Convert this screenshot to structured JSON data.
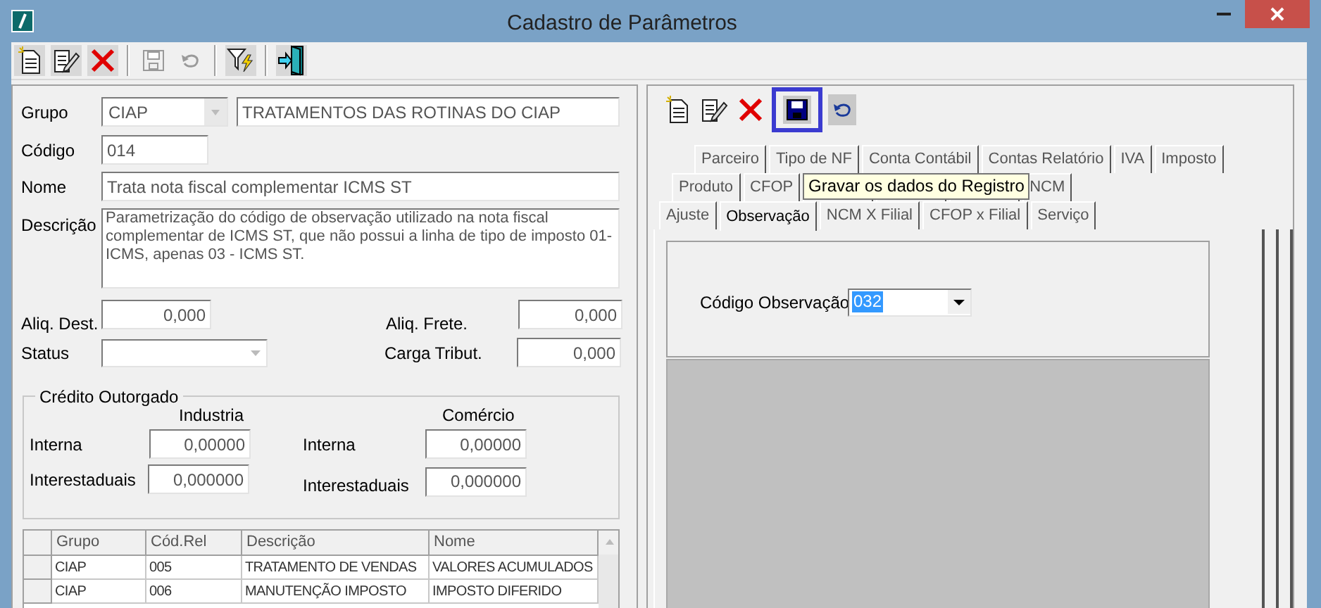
{
  "window": {
    "title": "Cadastro de Parâmetros"
  },
  "toolbar": [
    {
      "kind": "new",
      "disabled": false
    },
    {
      "kind": "edit",
      "disabled": false
    },
    {
      "kind": "delete",
      "disabled": false
    },
    {
      "kind": "save",
      "disabled": true
    },
    {
      "kind": "undo",
      "disabled": true
    },
    {
      "kind": "filter",
      "disabled": false
    },
    {
      "kind": "exit",
      "disabled": false
    }
  ],
  "form": {
    "grupo": {
      "label": "Grupo",
      "value": "CIAP",
      "description": "TRATAMENTOS DAS ROTINAS DO CIAP"
    },
    "codigo": {
      "label": "Código",
      "value": "014"
    },
    "nome": {
      "label": "Nome",
      "value": "Trata nota fiscal complementar ICMS ST"
    },
    "descricao": {
      "label": "Descrição",
      "value": "Parametrização do código de observação utilizado na nota fiscal complementar de ICMS ST, que não possui a linha de tipo de imposto 01-ICMS, apenas 03 - ICMS ST."
    },
    "aliq_dest": {
      "label": "Aliq. Dest.",
      "value": "0,000"
    },
    "aliq_frete": {
      "label": "Aliq. Frete.",
      "value": "0,000"
    },
    "status": {
      "label": "Status"
    },
    "carga_tribut": {
      "label": "Carga Tribut.",
      "value": "0,000"
    }
  },
  "credito_outorgado": {
    "title": "Crédito Outorgado",
    "columns": [
      {
        "heading": "Industria",
        "interna": {
          "label": "Interna",
          "value": "0,00000"
        },
        "interestaduais": {
          "label": "Interestaduais",
          "value": "0,000000"
        }
      },
      {
        "heading": "Comércio",
        "interna": {
          "label": "Interna",
          "value": "0,00000"
        },
        "interestaduais": {
          "label": "Interestaduais",
          "value": "0,000000"
        }
      }
    ]
  },
  "grid": {
    "columns": [
      "Grupo",
      "Cód.Rel",
      "Descrição",
      "Nome"
    ],
    "rows": [
      [
        "CIAP",
        "005",
        "TRATAMENTO DE VENDAS",
        "VALORES ACUMULADOS"
      ],
      [
        "CIAP",
        "006",
        "MANUTENÇÃO IMPOSTO",
        "IMPOSTO DIFERIDO"
      ]
    ]
  },
  "detail_toolbar": [
    {
      "kind": "new",
      "hovered": false
    },
    {
      "kind": "edit",
      "hovered": false
    },
    {
      "kind": "delete",
      "hovered": false
    },
    {
      "kind": "save",
      "hovered": true
    },
    {
      "kind": "undo",
      "hovered": false
    }
  ],
  "tooltip": "Gravar os dados do Registro",
  "tab_rows": [
    [
      {
        "label": "Parceiro",
        "selected": false
      },
      {
        "label": "Tipo de NF",
        "selected": false
      },
      {
        "label": "Conta Contábil",
        "selected": false
      },
      {
        "label": "Contas Relatório",
        "selected": false
      },
      {
        "label": "IVA",
        "selected": false
      },
      {
        "label": "Imposto",
        "selected": false
      }
    ],
    [
      {
        "label": "Produto",
        "selected": false
      },
      {
        "label": "CFOP",
        "selected": false
      },
      {
        "selected": false
      },
      {
        "selected": false
      },
      {
        "selected": false
      },
      {
        "label": "NCM",
        "selected": false
      }
    ],
    [
      {
        "label": "Ajuste",
        "selected": false
      },
      {
        "label": "Observação",
        "selected": true
      },
      {
        "label": "NCM X Filial",
        "selected": false
      },
      {
        "label": "CFOP x Filial",
        "selected": false
      },
      {
        "label": "Serviço",
        "selected": false
      }
    ]
  ],
  "observacao": {
    "label": "Código Observação",
    "value": "032"
  }
}
